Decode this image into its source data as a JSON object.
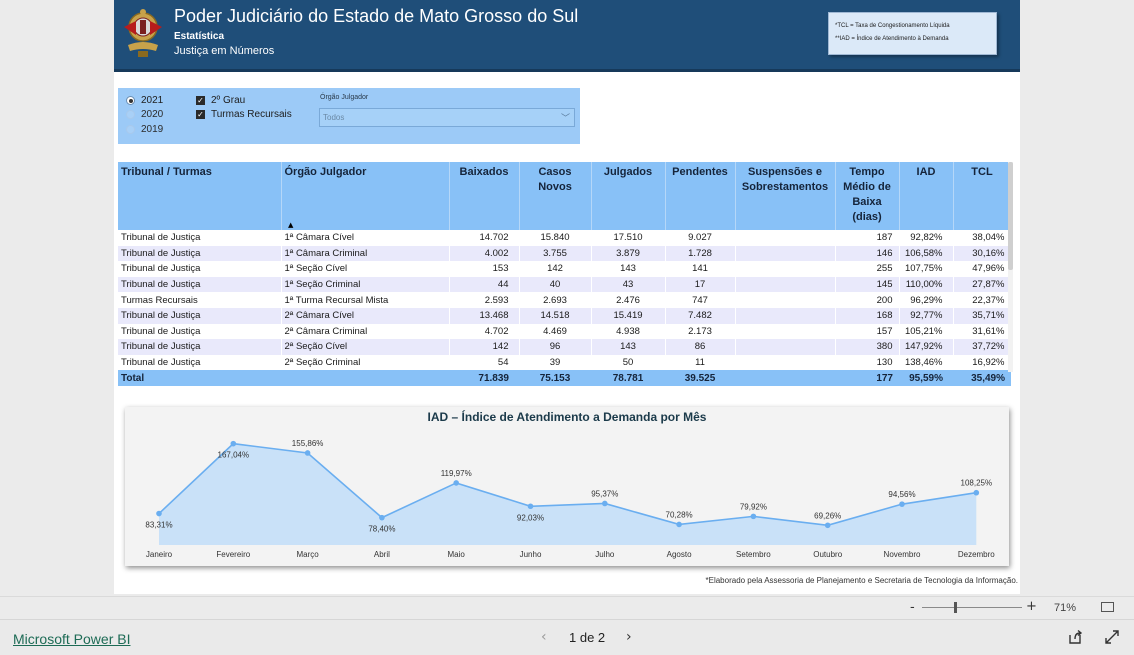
{
  "header": {
    "title": "Poder Judiciário do Estado de Mato Grosso do Sul",
    "subtitle": "Estatística",
    "subtitle2": "Justiça em Números",
    "legend_line1": "*TCL = Taxa de Congestionamento Líquida",
    "legend_line2": "**IAD = Índice de Atendimento à Demanda"
  },
  "filters": {
    "years": [
      {
        "label": "2021",
        "selected": true
      },
      {
        "label": "2020",
        "selected": false
      },
      {
        "label": "2019",
        "selected": false
      }
    ],
    "checks": [
      {
        "label": "2º Grau",
        "checked": true
      },
      {
        "label": "Turmas Recursais",
        "checked": true
      }
    ],
    "orgao_label": "Órgão Julgador",
    "orgao_value": "Todos"
  },
  "table": {
    "headers": [
      "Tribunal / Turmas",
      "Órgão Julgador",
      "Baixados",
      "Casos Novos",
      "Julgados",
      "Pendentes",
      "Suspensões e Sobrestamentos",
      "Tempo Médio de Baixa (dias)",
      "IAD",
      "TCL"
    ],
    "rows": [
      [
        "Tribunal de Justiça",
        "1ª Câmara Cível",
        "14.702",
        "15.840",
        "17.510",
        "9.027",
        "",
        "187",
        "92,82%",
        "38,04%"
      ],
      [
        "Tribunal de Justiça",
        "1ª Câmara Criminal",
        "4.002",
        "3.755",
        "3.879",
        "1.728",
        "",
        "146",
        "106,58%",
        "30,16%"
      ],
      [
        "Tribunal de Justiça",
        "1ª Seção Cível",
        "153",
        "142",
        "143",
        "141",
        "",
        "255",
        "107,75%",
        "47,96%"
      ],
      [
        "Tribunal de Justiça",
        "1ª Seção Criminal",
        "44",
        "40",
        "43",
        "17",
        "",
        "145",
        "110,00%",
        "27,87%"
      ],
      [
        "Turmas Recursais",
        "1ª Turma Recursal Mista",
        "2.593",
        "2.693",
        "2.476",
        "747",
        "",
        "200",
        "96,29%",
        "22,37%"
      ],
      [
        "Tribunal de Justiça",
        "2ª Câmara Cível",
        "13.468",
        "14.518",
        "15.419",
        "7.482",
        "",
        "168",
        "92,77%",
        "35,71%"
      ],
      [
        "Tribunal de Justiça",
        "2ª Câmara Criminal",
        "4.702",
        "4.469",
        "4.938",
        "2.173",
        "",
        "157",
        "105,21%",
        "31,61%"
      ],
      [
        "Tribunal de Justiça",
        "2ª Seção Cível",
        "142",
        "96",
        "143",
        "86",
        "",
        "380",
        "147,92%",
        "37,72%"
      ],
      [
        "Tribunal de Justiça",
        "2ª Seção Criminal",
        "54",
        "39",
        "50",
        "11",
        "",
        "130",
        "138,46%",
        "16,92%"
      ]
    ],
    "total": [
      "Total",
      "",
      "71.839",
      "75.153",
      "78.781",
      "39.525",
      "",
      "177",
      "95,59%",
      "35,49%"
    ]
  },
  "chart_data": {
    "type": "area",
    "title": "IAD – Índice de Atendimento a Demanda por Mês",
    "categories": [
      "Janeiro",
      "Fevereiro",
      "Março",
      "Abril",
      "Maio",
      "Junho",
      "Julho",
      "Agosto",
      "Setembro",
      "Outubro",
      "Novembro",
      "Dezembro"
    ],
    "values": [
      83.31,
      167.04,
      155.86,
      78.4,
      119.97,
      92.03,
      95.37,
      70.28,
      79.92,
      69.26,
      94.56,
      108.25
    ],
    "labels": [
      "83,31%",
      "167,04%",
      "155,86%",
      "78,40%",
      "119,97%",
      "92,03%",
      "95,37%",
      "70,28%",
      "79,92%",
      "69,26%",
      "94,56%",
      "108,25%"
    ],
    "label_below": [
      true,
      true,
      false,
      true,
      false,
      true,
      false,
      false,
      false,
      false,
      false,
      false
    ],
    "line_color": "#6aaef0",
    "fill_color": "#c9e1f8"
  },
  "footnote": "*Elaborado pela Assessoria de Planejamento e Secretaria de Tecnologia da Informação.",
  "zoom": {
    "minus": "-",
    "plus": "+",
    "percent": "71%"
  },
  "footer": {
    "brand": "Microsoft Power BI",
    "page": "1 de 2",
    "prev": "‹",
    "next": "›"
  }
}
